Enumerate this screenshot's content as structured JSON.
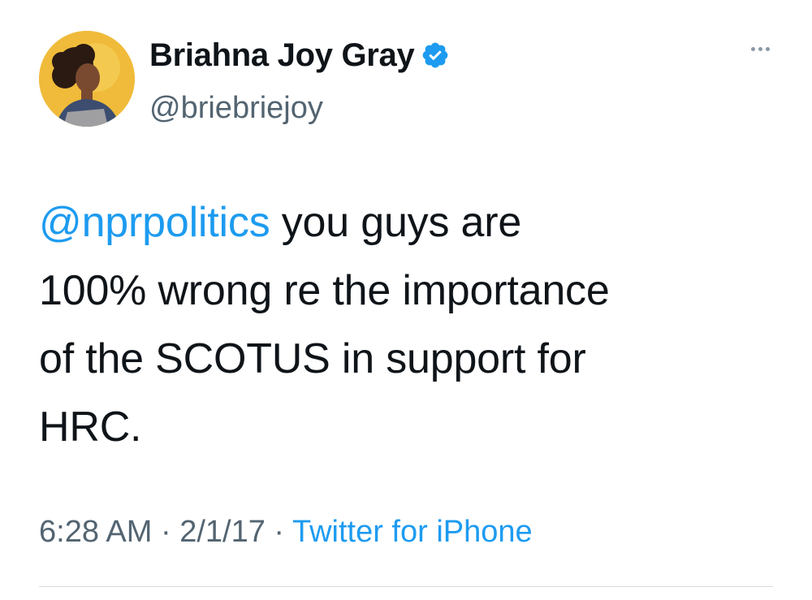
{
  "author": {
    "display_name": "Briahna Joy Gray",
    "handle": "@briebriejoy",
    "verified": true
  },
  "tweet": {
    "mention": "@nprpolitics",
    "text_line1": " you guys are",
    "text_line2": "100% wrong re the importance",
    "text_line3": "of the SCOTUS in support for",
    "text_line4": "HRC."
  },
  "meta": {
    "time": "6:28 AM",
    "separator1": " · ",
    "date": "2/1/17",
    "separator2": " · ",
    "source": "Twitter for iPhone"
  },
  "icons": {
    "verified_badge": "verified-check-icon",
    "more_menu": "more-dots-icon"
  },
  "colors": {
    "accent": "#1d9bf0",
    "text": "#0f1419",
    "secondary": "#536471"
  }
}
